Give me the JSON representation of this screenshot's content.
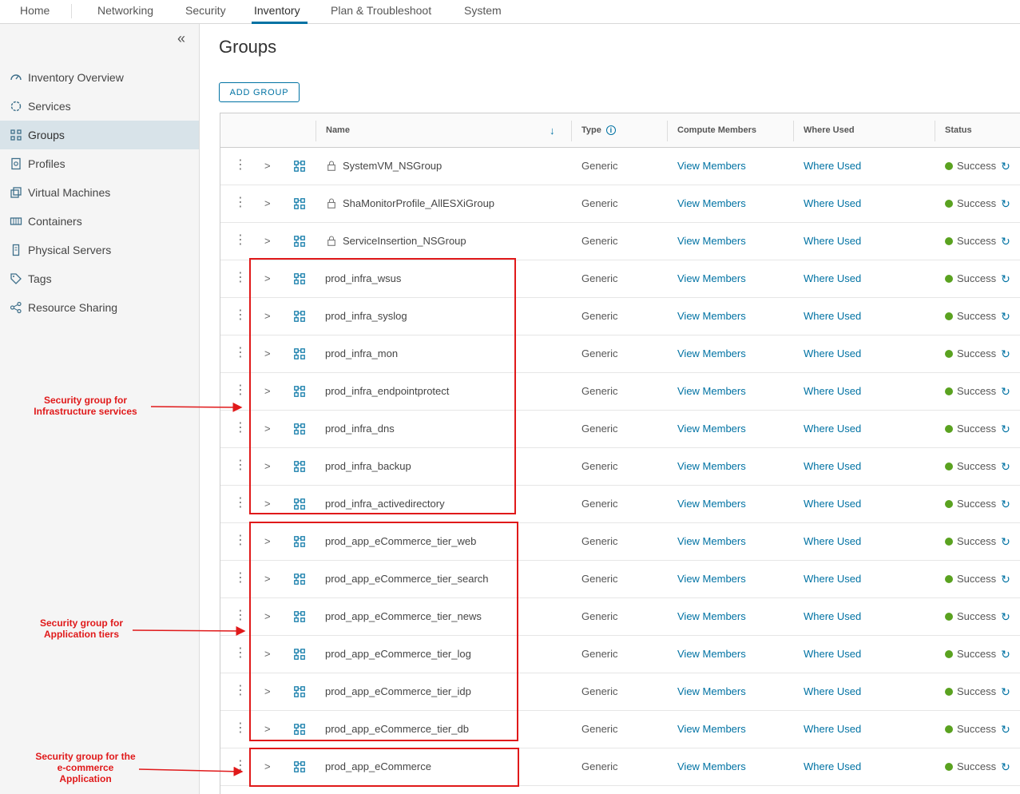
{
  "topnav": {
    "tabs": [
      {
        "label": "Home"
      },
      {
        "label": "Networking"
      },
      {
        "label": "Security"
      },
      {
        "label": "Inventory",
        "active": true
      },
      {
        "label": "Plan & Troubleshoot"
      },
      {
        "label": "System"
      }
    ]
  },
  "sidebar": {
    "collapse_icon": "double-chevron-left-icon",
    "items": [
      {
        "label": "Inventory Overview",
        "icon": "gauge-icon"
      },
      {
        "label": "Services",
        "icon": "gear-icon"
      },
      {
        "label": "Groups",
        "icon": "groups-icon",
        "active": true
      },
      {
        "label": "Profiles",
        "icon": "profile-icon"
      },
      {
        "label": "Virtual Machines",
        "icon": "vm-icon"
      },
      {
        "label": "Containers",
        "icon": "container-icon"
      },
      {
        "label": "Physical Servers",
        "icon": "server-icon"
      },
      {
        "label": "Tags",
        "icon": "tag-icon"
      },
      {
        "label": "Resource Sharing",
        "icon": "share-icon"
      }
    ]
  },
  "page": {
    "title": "Groups",
    "add_button": "ADD GROUP"
  },
  "table": {
    "columns": {
      "name": "Name",
      "type": "Type",
      "compute": "Compute Members",
      "where": "Where Used",
      "status": "Status"
    },
    "rows": [
      {
        "name": "SystemVM_NSGroup",
        "locked": true,
        "type": "Generic",
        "members": "View Members",
        "where": "Where Used",
        "status": "Success"
      },
      {
        "name": "ShaMonitorProfile_AllESXiGroup",
        "locked": true,
        "type": "Generic",
        "members": "View Members",
        "where": "Where Used",
        "status": "Success"
      },
      {
        "name": "ServiceInsertion_NSGroup",
        "locked": true,
        "type": "Generic",
        "members": "View Members",
        "where": "Where Used",
        "status": "Success"
      },
      {
        "name": "prod_infra_wsus",
        "locked": false,
        "type": "Generic",
        "members": "View Members",
        "where": "Where Used",
        "status": "Success"
      },
      {
        "name": "prod_infra_syslog",
        "locked": false,
        "type": "Generic",
        "members": "View Members",
        "where": "Where Used",
        "status": "Success"
      },
      {
        "name": "prod_infra_mon",
        "locked": false,
        "type": "Generic",
        "members": "View Members",
        "where": "Where Used",
        "status": "Success"
      },
      {
        "name": "prod_infra_endpointprotect",
        "locked": false,
        "type": "Generic",
        "members": "View Members",
        "where": "Where Used",
        "status": "Success"
      },
      {
        "name": "prod_infra_dns",
        "locked": false,
        "type": "Generic",
        "members": "View Members",
        "where": "Where Used",
        "status": "Success"
      },
      {
        "name": "prod_infra_backup",
        "locked": false,
        "type": "Generic",
        "members": "View Members",
        "where": "Where Used",
        "status": "Success"
      },
      {
        "name": "prod_infra_activedirectory",
        "locked": false,
        "type": "Generic",
        "members": "View Members",
        "where": "Where Used",
        "status": "Success"
      },
      {
        "name": "prod_app_eCommerce_tier_web",
        "locked": false,
        "type": "Generic",
        "members": "View Members",
        "where": "Where Used",
        "status": "Success"
      },
      {
        "name": "prod_app_eCommerce_tier_search",
        "locked": false,
        "type": "Generic",
        "members": "View Members",
        "where": "Where Used",
        "status": "Success"
      },
      {
        "name": "prod_app_eCommerce_tier_news",
        "locked": false,
        "type": "Generic",
        "members": "View Members",
        "where": "Where Used",
        "status": "Success"
      },
      {
        "name": "prod_app_eCommerce_tier_log",
        "locked": false,
        "type": "Generic",
        "members": "View Members",
        "where": "Where Used",
        "status": "Success"
      },
      {
        "name": "prod_app_eCommerce_tier_idp",
        "locked": false,
        "type": "Generic",
        "members": "View Members",
        "where": "Where Used",
        "status": "Success"
      },
      {
        "name": "prod_app_eCommerce_tier_db",
        "locked": false,
        "type": "Generic",
        "members": "View Members",
        "where": "Where Used",
        "status": "Success"
      },
      {
        "name": "prod_app_eCommerce",
        "locked": false,
        "type": "Generic",
        "members": "View Members",
        "where": "Where Used",
        "status": "Success"
      }
    ]
  },
  "annotations": {
    "infra": {
      "line1": "Security group for",
      "line2": "Infrastructure services"
    },
    "app": {
      "line1": "Security group for",
      "line2": "Application tiers"
    },
    "ecommerce": {
      "line1": "Security group for the",
      "line2": "e-commerce",
      "line3": "Application"
    }
  },
  "colors": {
    "accent": "#0072a3",
    "success": "#5aa220",
    "annotation": "#e0191a",
    "sidebar_active": "#d8e3e9"
  }
}
